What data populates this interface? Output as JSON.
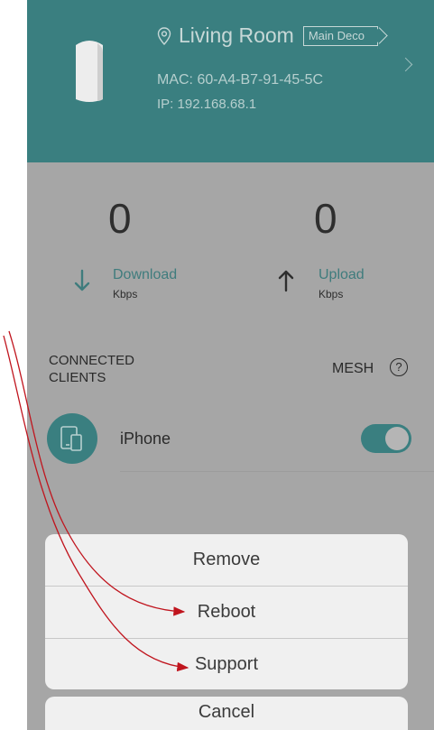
{
  "header": {
    "location": "Living Room",
    "badge": "Main Deco",
    "mac": "MAC: 60-A4-B7-91-45-5C",
    "ip": "IP: 192.168.68.1"
  },
  "stats": {
    "download": {
      "value": "0",
      "label": "Download",
      "unit": "Kbps"
    },
    "upload": {
      "value": "0",
      "label": "Upload",
      "unit": "Kbps"
    }
  },
  "clients": {
    "title_line1": "CONNECTED",
    "title_line2": "CLIENTS",
    "mesh_label": "MESH",
    "help": "?",
    "items": [
      {
        "name": "iPhone",
        "enabled": true
      }
    ]
  },
  "action_sheet": {
    "items": [
      "Remove",
      "Reboot",
      "Support"
    ],
    "cancel": "Cancel"
  },
  "colors": {
    "accent": "#3a7f80",
    "annotation": "#c0151e"
  }
}
